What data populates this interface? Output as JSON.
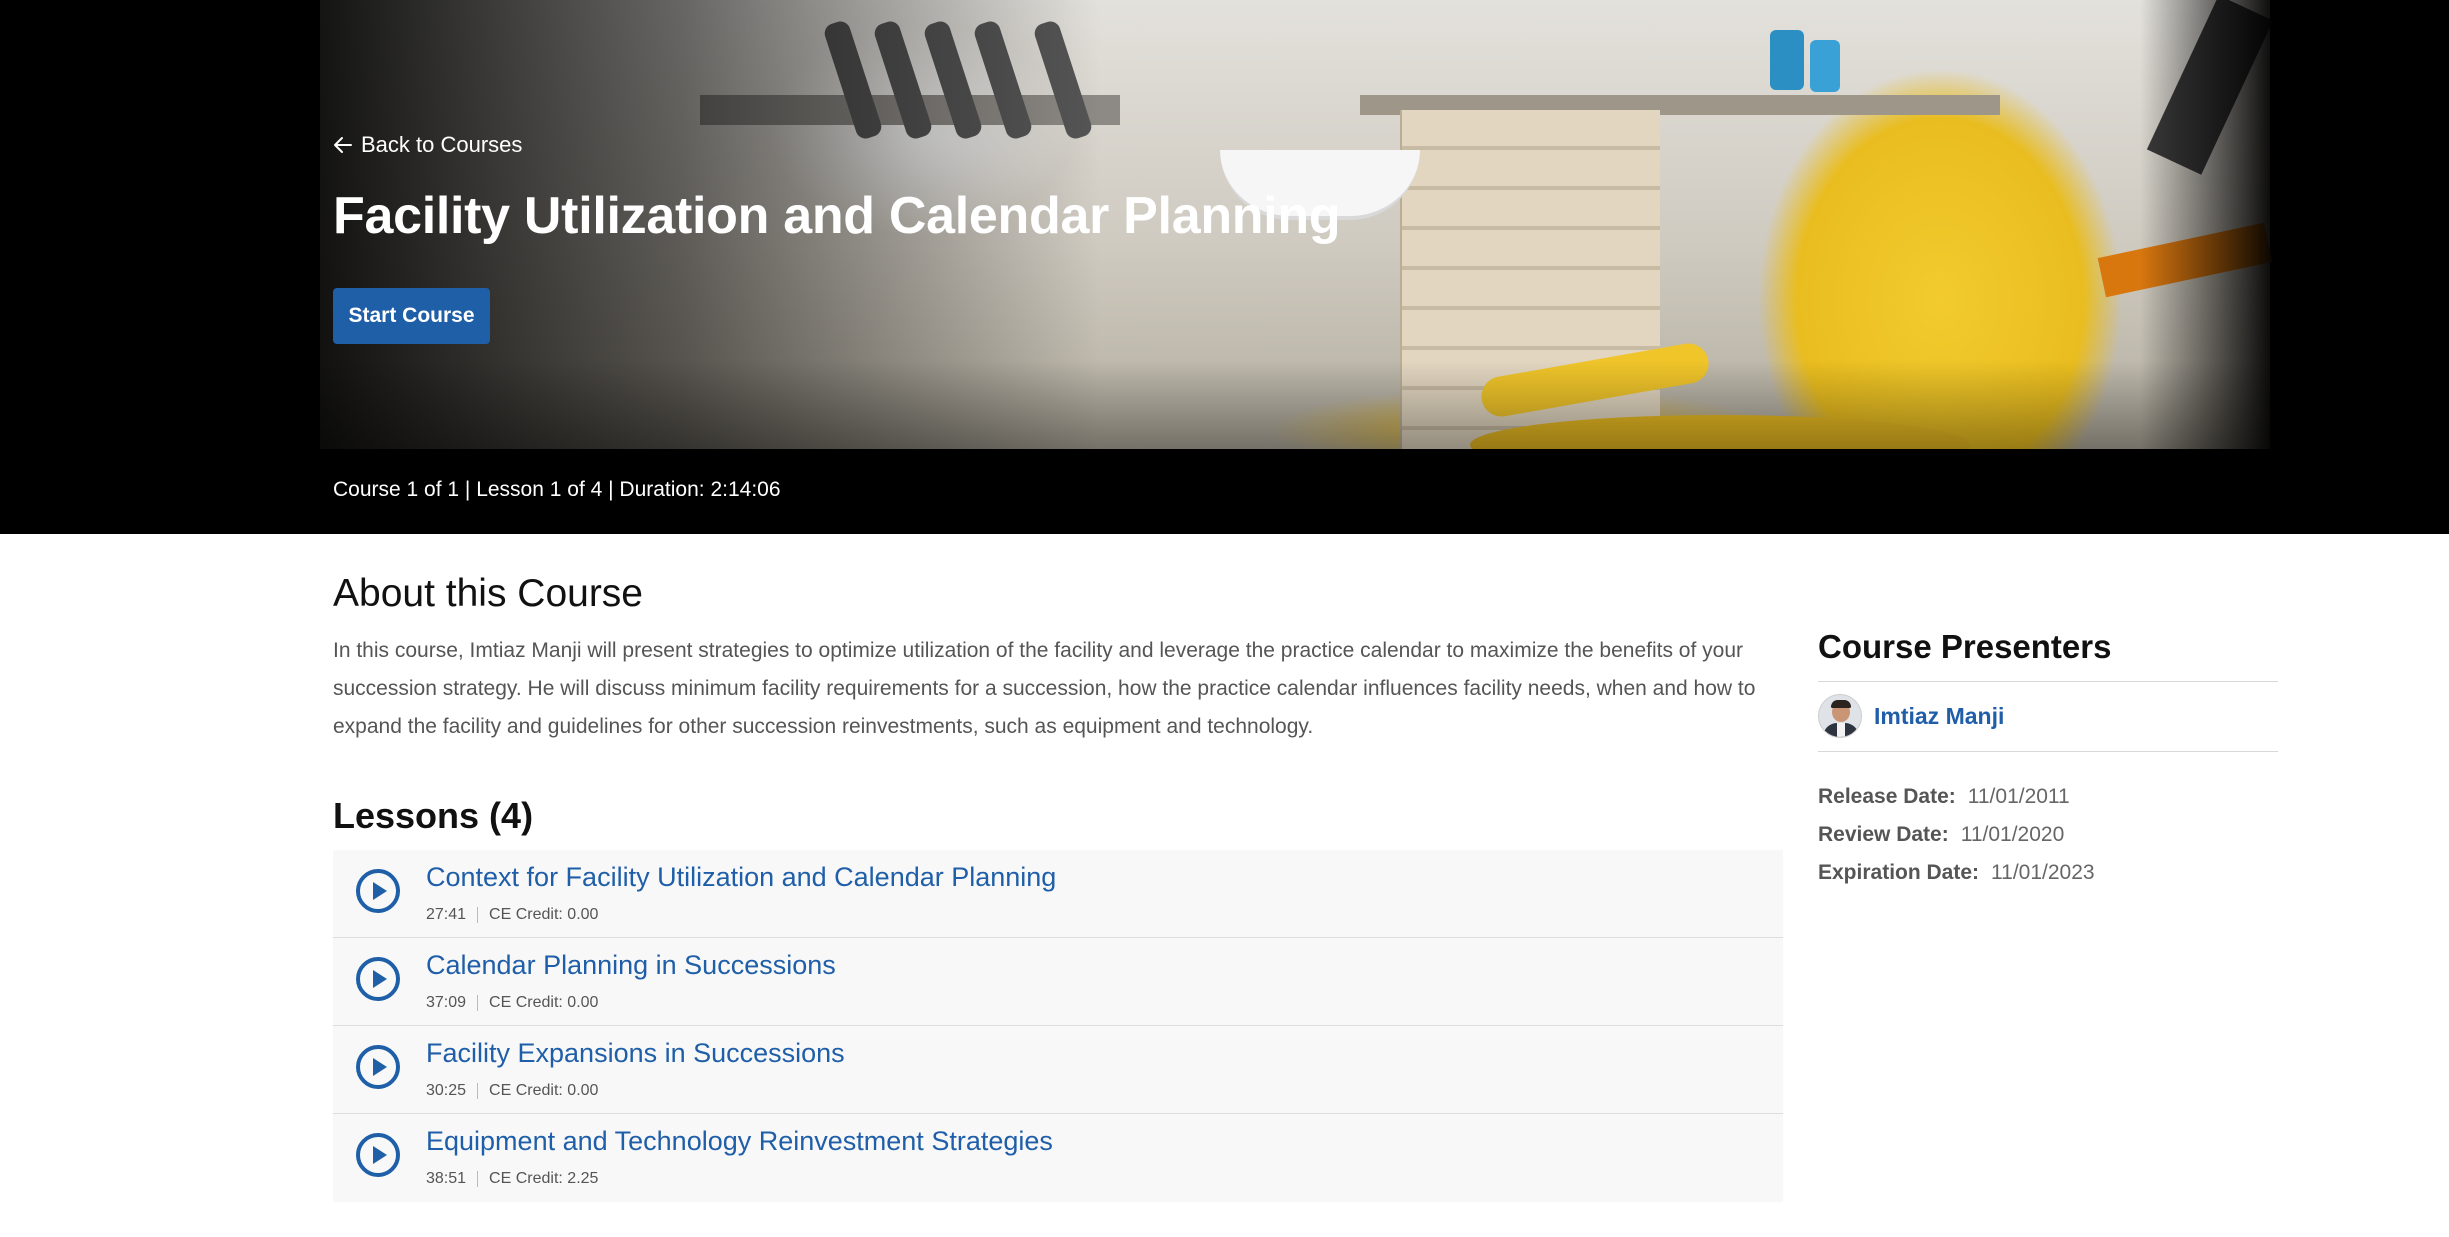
{
  "hero": {
    "back_label": "Back to Courses",
    "title": "Facility Utilization and Calendar Planning",
    "start_label": "Start Course",
    "meta": "Course 1 of 1 | Lesson 1 of 4 | Duration: 2:14:06"
  },
  "about": {
    "title": "About this Course",
    "text": "In this course, Imtiaz Manji will present strategies to optimize utilization of the facility and leverage the practice calendar to maximize the benefits of your succession strategy. He will discuss minimum facility requirements for a succession, how the practice calendar influences facility needs, when and how to expand the facility and guidelines for other succession reinvestments, such as equipment and technology."
  },
  "lessons": {
    "title": "Lessons (4)",
    "items": [
      {
        "title": "Context for Facility Utilization and Calendar Planning",
        "duration": "27:41",
        "credit": "CE Credit: 0.00"
      },
      {
        "title": "Calendar Planning in Successions",
        "duration": "37:09",
        "credit": "CE Credit: 0.00"
      },
      {
        "title": "Facility Expansions in Successions",
        "duration": "30:25",
        "credit": "CE Credit: 0.00"
      },
      {
        "title": "Equipment and Technology Reinvestment Strategies",
        "duration": "38:51",
        "credit": "CE Credit: 2.25"
      }
    ]
  },
  "sidebar": {
    "title": "Course Presenters",
    "presenter_name": "Imtiaz Manji",
    "dates": [
      {
        "label": "Release Date:",
        "value": "11/01/2011"
      },
      {
        "label": "Review Date:",
        "value": "11/01/2020"
      },
      {
        "label": "Expiration Date:",
        "value": "11/01/2023"
      }
    ]
  },
  "colors": {
    "accent": "#1e5fa8",
    "link": "#1f5ea8",
    "hero_bg": "#000000"
  },
  "icons": {
    "back": "arrow-left-icon",
    "play": "play-circle-icon",
    "avatar": "presenter-avatar"
  }
}
